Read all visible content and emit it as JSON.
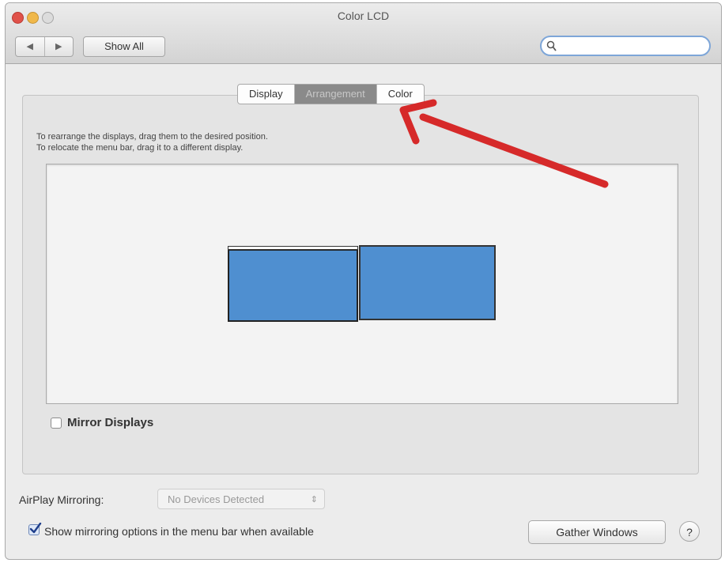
{
  "window": {
    "title": "Color LCD"
  },
  "toolbar": {
    "back_icon": "◀",
    "forward_icon": "▶",
    "show_all_label": "Show All",
    "search_placeholder": ""
  },
  "tabs": [
    {
      "label": "Display",
      "selected": false
    },
    {
      "label": "Arrangement",
      "selected": true
    },
    {
      "label": "Color",
      "selected": false
    }
  ],
  "arrangement": {
    "instruction_1": "To rearrange the displays, drag them to the desired position.",
    "instruction_2": "To relocate the menu bar, drag it to a different display.",
    "display_color": "#4f8fd0",
    "mirror_label": "Mirror Displays",
    "mirror_checked": false
  },
  "airplay": {
    "label": "AirPlay Mirroring:",
    "selected_value": "No Devices Detected",
    "chevron": "⌃⌄"
  },
  "menu_option": {
    "label": "Show mirroring options in the menu bar when available",
    "checked": true
  },
  "buttons": {
    "gather_label": "Gather Windows",
    "help_label": "?"
  },
  "annotation": {
    "arrow_color": "#d62a2a"
  }
}
